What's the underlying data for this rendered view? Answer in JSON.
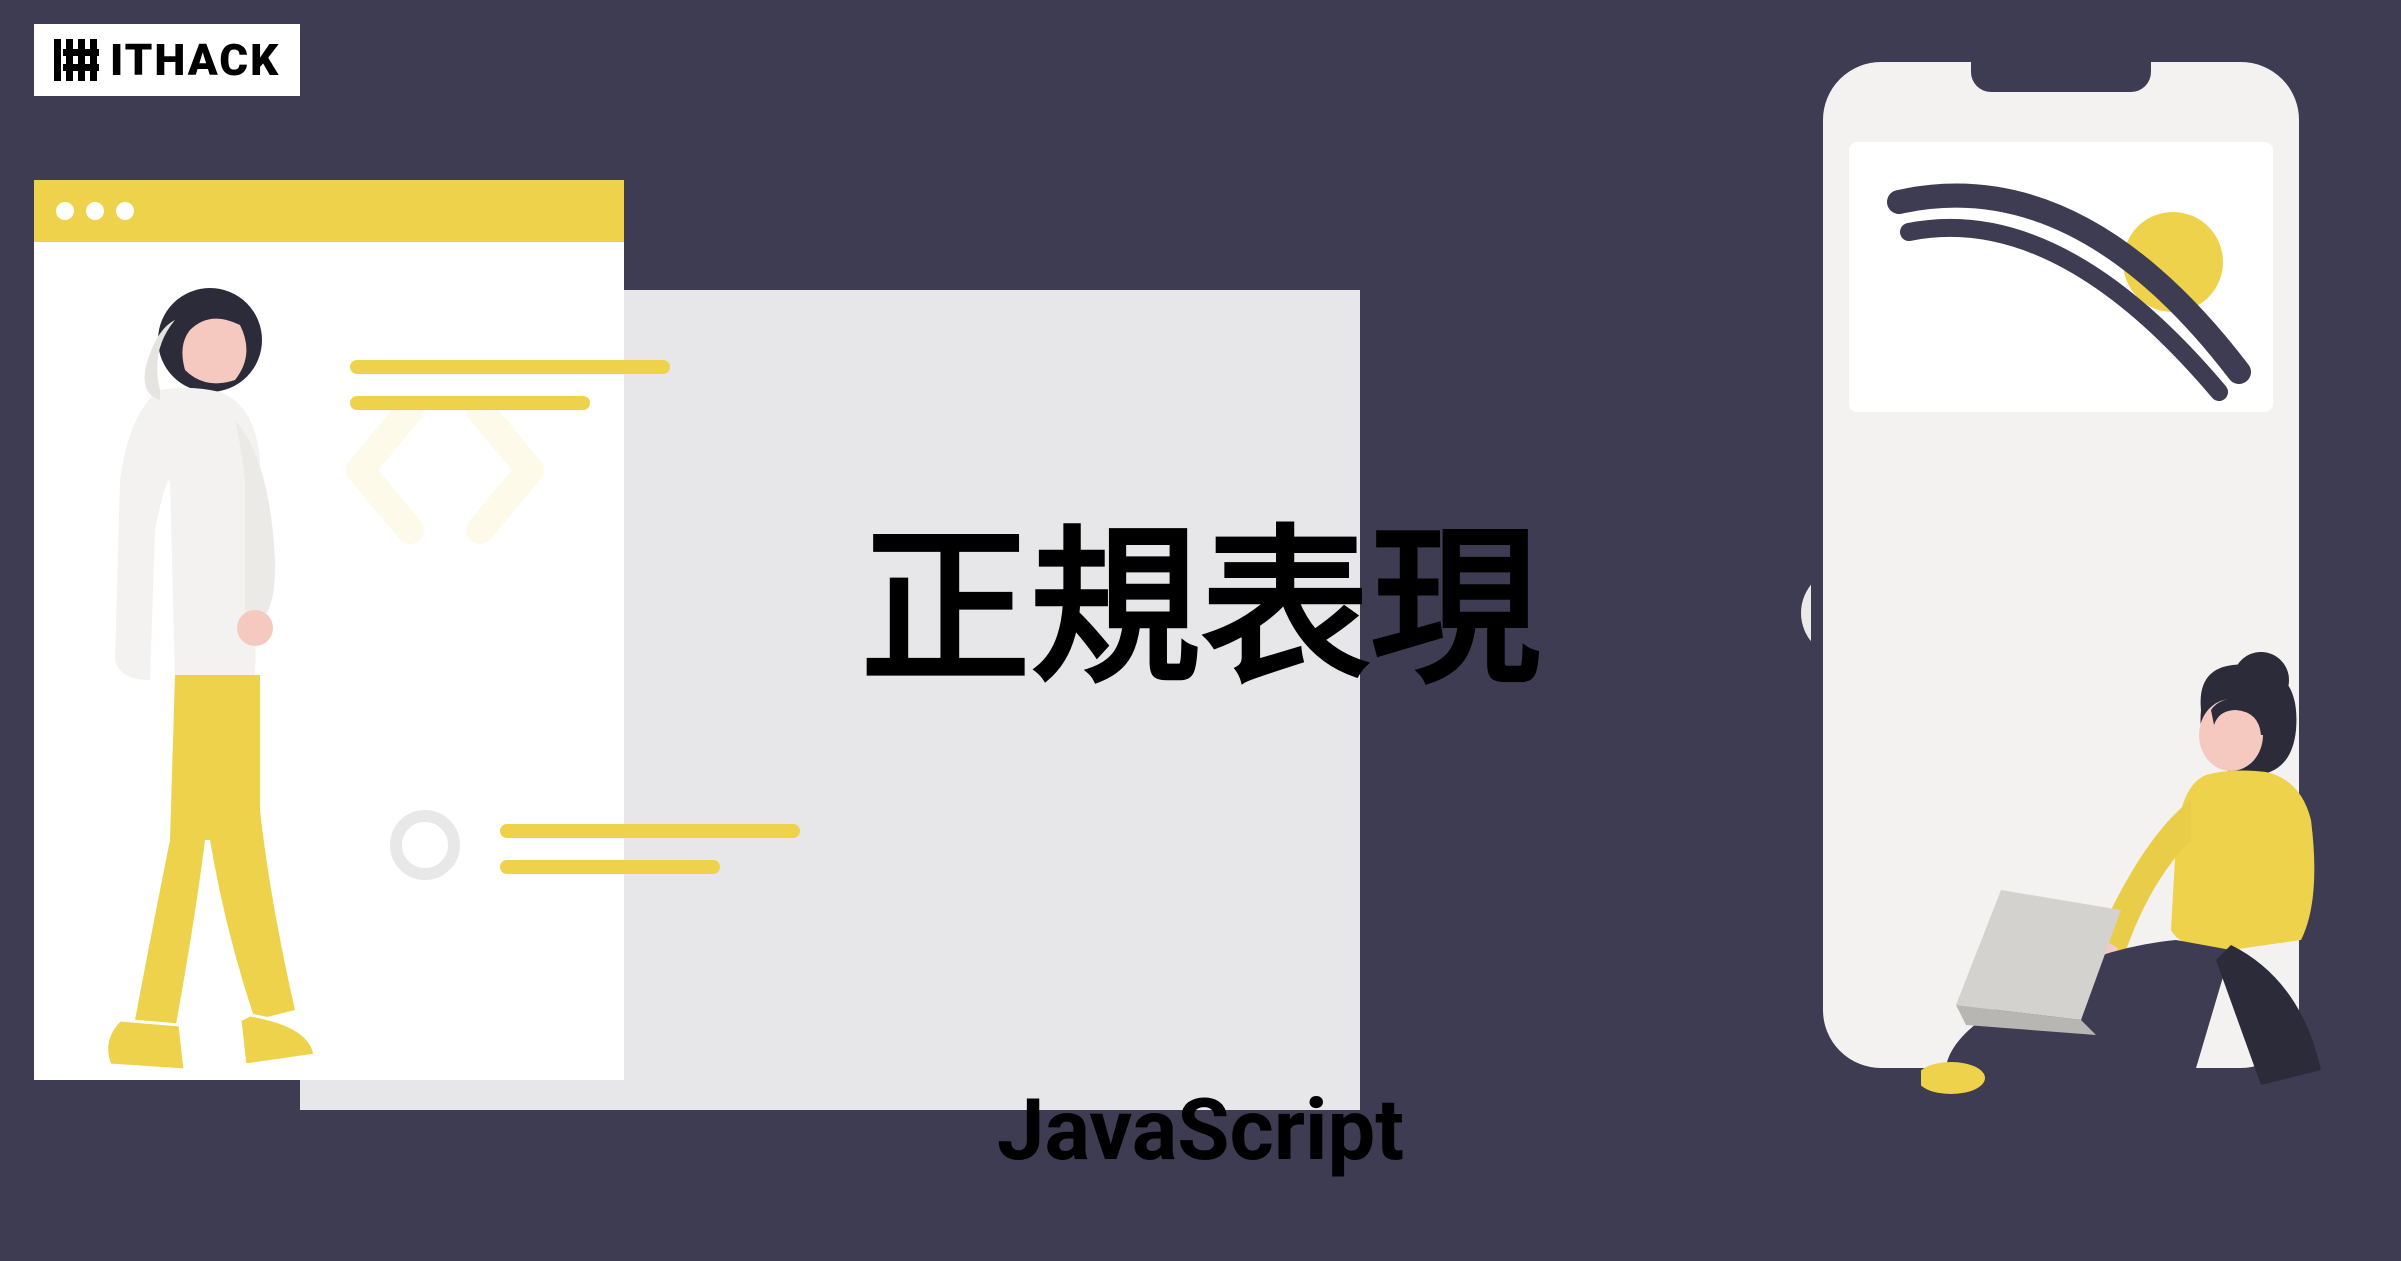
{
  "logo": {
    "text": "ITHACK"
  },
  "main_title": "正規表現",
  "subtitle": "JavaScript",
  "colors": {
    "background": "#3d3c52",
    "accent": "#eed24b",
    "white": "#ffffff",
    "skin": "#f5c9c0",
    "hair": "#2b2b3a"
  }
}
